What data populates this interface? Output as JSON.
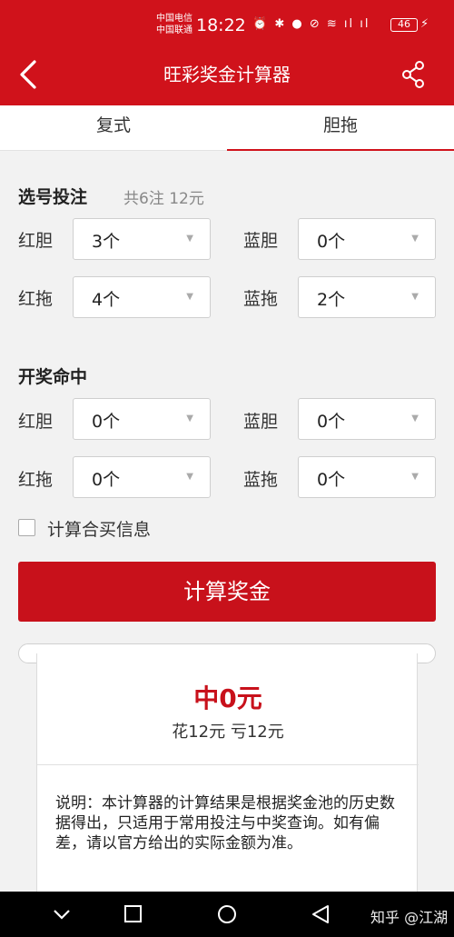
{
  "status": {
    "carrier1": "中国电信",
    "carrier2": "中国联通",
    "time": "18:22",
    "icons": "⏰ ✱ ● ⊘ ≋ ıl ıl",
    "battery": "46"
  },
  "header": {
    "title": "旺彩奖金计算器"
  },
  "tabs": [
    {
      "label": "复式"
    },
    {
      "label": "胆拖"
    }
  ],
  "bet": {
    "title": "选号投注",
    "summary": "共6注 12元",
    "red_dan": {
      "label": "红胆",
      "value": "3个"
    },
    "blue_dan": {
      "label": "蓝胆",
      "value": "0个"
    },
    "red_tuo": {
      "label": "红拖",
      "value": "4个"
    },
    "blue_tuo": {
      "label": "蓝拖",
      "value": "2个"
    }
  },
  "hit": {
    "title": "开奖命中",
    "red_dan": {
      "label": "红胆",
      "value": "0个"
    },
    "blue_dan": {
      "label": "蓝胆",
      "value": "0个"
    },
    "red_tuo": {
      "label": "红拖",
      "value": "0个"
    },
    "blue_tuo": {
      "label": "蓝拖",
      "value": "0个"
    }
  },
  "joint": {
    "label": "计算合买信息"
  },
  "calc_button": "计算奖金",
  "result": {
    "prize": "中0元",
    "spent": "花12元 亏12元",
    "note": "说明：本计算器的计算结果是根据奖金池的历史数据得出，只适用于常用投注与中奖查询。如有偏差，请以官方给出的实际金额为准。"
  },
  "watermark": "知乎 @江湖",
  "colors": {
    "brand": "#d0121b",
    "button": "#c8111b"
  }
}
